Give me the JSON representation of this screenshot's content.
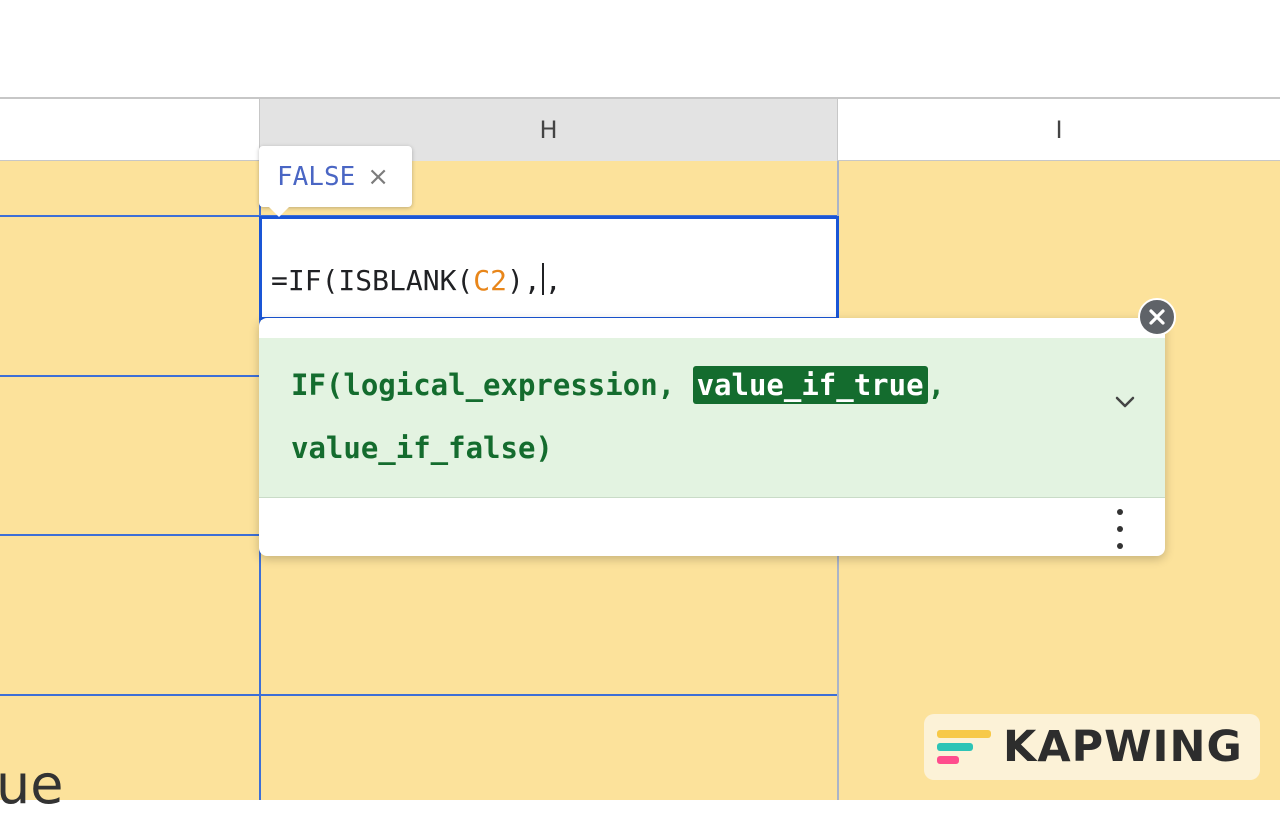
{
  "columns": {
    "h": "H",
    "i": "I"
  },
  "cell_partial_text": "ue",
  "formula": {
    "prefix": "=IF(ISBLANK(",
    "ref": "C2",
    "after_ref": "),",
    "after_caret": ",",
    "ref_color": "#e8861a"
  },
  "preview": {
    "value": "FALSE",
    "close_symbol": "×"
  },
  "function_help": {
    "line1_before": "IF(logical_expression, ",
    "active_arg": "value_if_true",
    "line1_after": ",",
    "line2": "value_if_false)",
    "expand_icon": "chevron-down-icon",
    "more_icon": "more-vertical-icon",
    "close_icon": "close-circle-icon"
  },
  "watermark": {
    "text": "KAPWING"
  },
  "colors": {
    "cell_fill": "#fce29b",
    "selection_border": "#1a56d6",
    "help_background": "#e3f3e1",
    "help_text": "#146c2e"
  }
}
